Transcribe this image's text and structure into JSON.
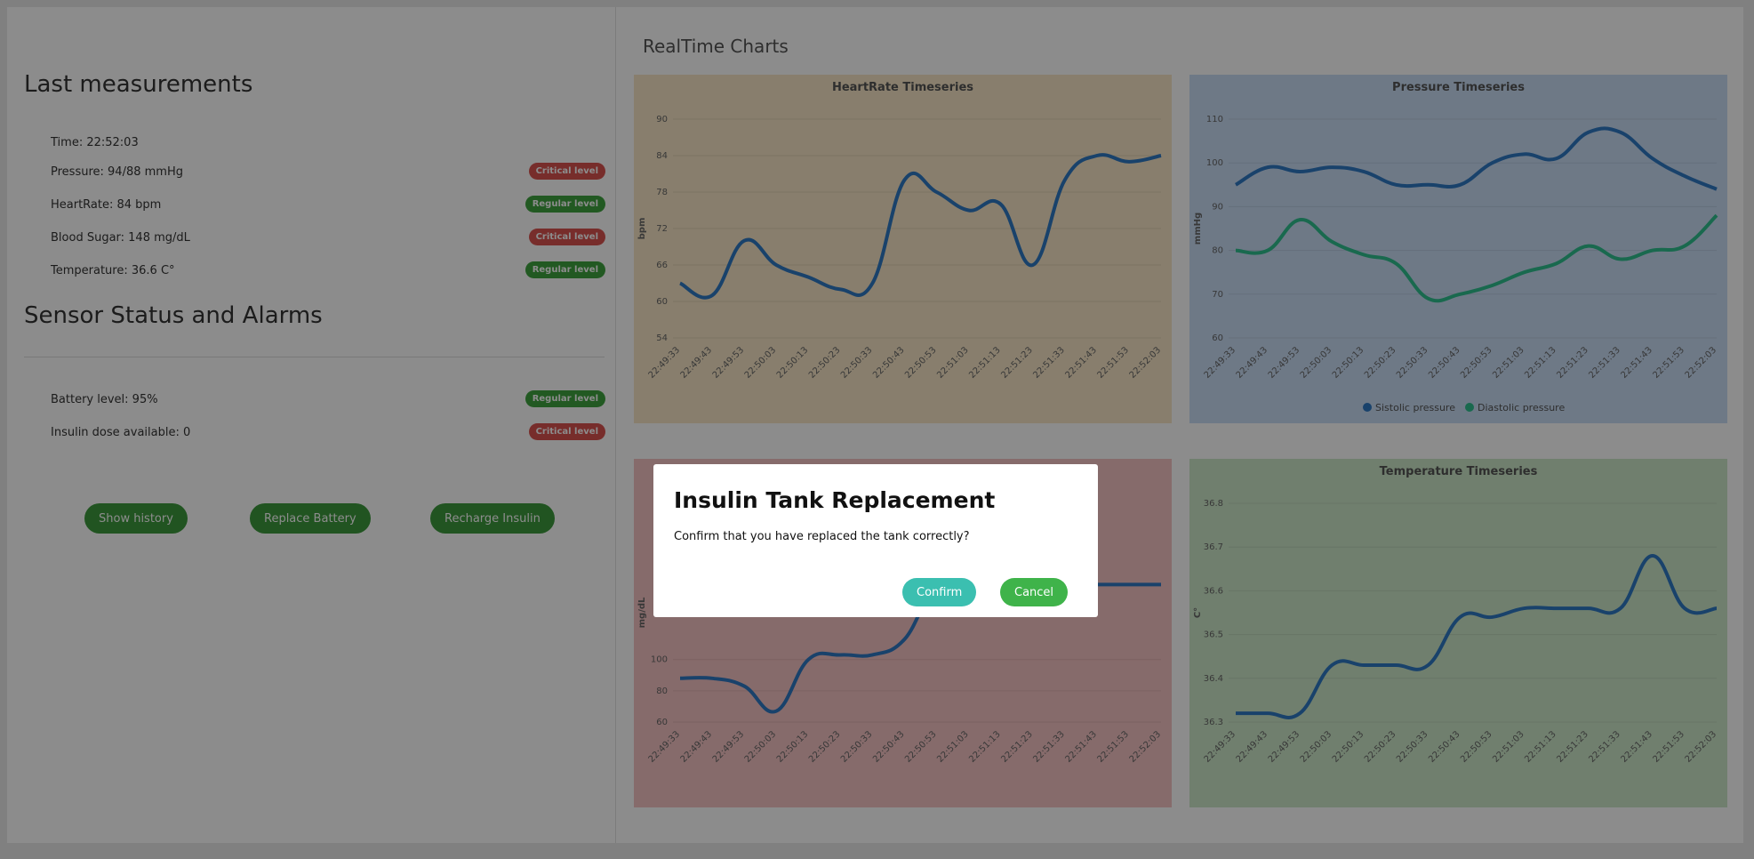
{
  "left": {
    "last_title": "Last measurements",
    "measurements": [
      {
        "label": "Time: 22:52:03",
        "badge": ""
      },
      {
        "label": "Pressure: 94/88 mmHg",
        "badge": "Critical level",
        "status": "critical"
      },
      {
        "label": "HeartRate: 84 bpm",
        "badge": "Regular level",
        "status": "regular"
      },
      {
        "label": "Blood Sugar: 148 mg/dL",
        "badge": "Critical level",
        "status": "critical"
      },
      {
        "label": "Temperature: 36.6 C°",
        "badge": "Regular level",
        "status": "regular"
      }
    ],
    "sensor_title": "Sensor Status and Alarms",
    "sensors": [
      {
        "label": "Battery level: 95%",
        "badge": "Regular level",
        "status": "regular"
      },
      {
        "label": "Insulin dose available: 0",
        "badge": "Critical level",
        "status": "critical"
      }
    ],
    "buttons": {
      "history": "Show history",
      "battery": "Replace Battery",
      "insulin": "Recharge Insulin"
    }
  },
  "right": {
    "title": "RealTime Charts"
  },
  "colors": {
    "critical": "#d9534f",
    "regular": "#3fa33f",
    "line_blue": "#2f78c4",
    "line_green": "#2fbf8f",
    "confirm": "#3bbfb0",
    "cancel": "#3fb34a"
  },
  "chart_data": [
    {
      "type": "line",
      "title": "HeartRate Timeseries",
      "ylabel": "bpm",
      "background": "#f7e6c7",
      "ylim": [
        54,
        90
      ],
      "yticks": [
        54,
        60,
        66,
        72,
        78,
        84,
        90
      ],
      "x": [
        "22:49:33",
        "22:49:43",
        "22:49:53",
        "22:50:03",
        "22:50:13",
        "22:50:23",
        "22:50:33",
        "22:50:43",
        "22:50:53",
        "22:51:03",
        "22:51:13",
        "22:51:23",
        "22:51:33",
        "22:51:43",
        "22:51:53",
        "22:52:03"
      ],
      "series": [
        {
          "values": [
            63,
            61,
            70,
            66,
            64,
            62,
            63,
            80,
            78,
            75,
            76,
            66,
            80,
            84,
            83,
            84
          ],
          "color": "#2f78c4"
        }
      ]
    },
    {
      "type": "line",
      "title": "Pressure Timeseries",
      "ylabel": "mmHg",
      "background": "#c8dcf5",
      "ylim": [
        60,
        110
      ],
      "yticks": [
        60,
        70,
        80,
        90,
        100,
        110
      ],
      "x": [
        "22:49:33",
        "22:49:43",
        "22:49:53",
        "22:50:03",
        "22:50:13",
        "22:50:23",
        "22:50:33",
        "22:50:43",
        "22:50:53",
        "22:51:03",
        "22:51:13",
        "22:51:23",
        "22:51:33",
        "22:51:43",
        "22:51:53",
        "22:52:03"
      ],
      "legend": "bottom",
      "series": [
        {
          "name": "Sistolic pressure",
          "values": [
            95,
            99,
            98,
            99,
            98,
            95,
            95,
            95,
            100,
            102,
            101,
            107,
            107,
            101,
            97,
            94
          ],
          "color": "#2f78c4"
        },
        {
          "name": "Diastolic pressure",
          "values": [
            80,
            80,
            87,
            82,
            79,
            77,
            69,
            70,
            72,
            75,
            77,
            81,
            78,
            80,
            81,
            88
          ],
          "color": "#2fbf8f"
        }
      ]
    },
    {
      "type": "line",
      "title": "",
      "ylabel": "mg/dL",
      "background": "#f5c3c3",
      "ylim": [
        60,
        200
      ],
      "yticks": [
        60,
        80,
        100
      ],
      "x": [
        "22:49:33",
        "22:49:43",
        "22:49:53",
        "22:50:03",
        "22:50:13",
        "22:50:23",
        "22:50:33",
        "22:50:43",
        "22:50:53",
        "22:51:03",
        "22:51:13",
        "22:51:23",
        "22:51:33",
        "22:51:43",
        "22:51:53",
        "22:52:03"
      ],
      "series": [
        {
          "values": [
            88,
            88,
            83,
            67,
            100,
            103,
            103,
            113,
            148,
            148,
            148,
            148,
            148,
            148,
            148,
            148
          ],
          "color": "#2f78c4"
        }
      ]
    },
    {
      "type": "line",
      "title": "Temperature Timeseries",
      "ylabel": "C°",
      "background": "#cde8c9",
      "ylim": [
        36.3,
        36.8
      ],
      "yticks": [
        36.3,
        36.4,
        36.5,
        36.6,
        36.7,
        36.8
      ],
      "x": [
        "22:49:33",
        "22:49:43",
        "22:49:53",
        "22:50:03",
        "22:50:13",
        "22:50:23",
        "22:50:33",
        "22:50:43",
        "22:50:53",
        "22:51:03",
        "22:51:13",
        "22:51:23",
        "22:51:33",
        "22:51:43",
        "22:51:53",
        "22:52:03"
      ],
      "series": [
        {
          "values": [
            36.32,
            36.32,
            36.32,
            36.43,
            36.43,
            36.43,
            36.43,
            36.54,
            36.54,
            36.56,
            36.56,
            36.56,
            36.56,
            36.68,
            36.56,
            36.56
          ],
          "color": "#2f78c4"
        }
      ]
    }
  ],
  "modal": {
    "title": "Insulin Tank Replacement",
    "message": "Confirm that you have replaced the tank correctly?",
    "confirm": "Confirm",
    "cancel": "Cancel"
  }
}
